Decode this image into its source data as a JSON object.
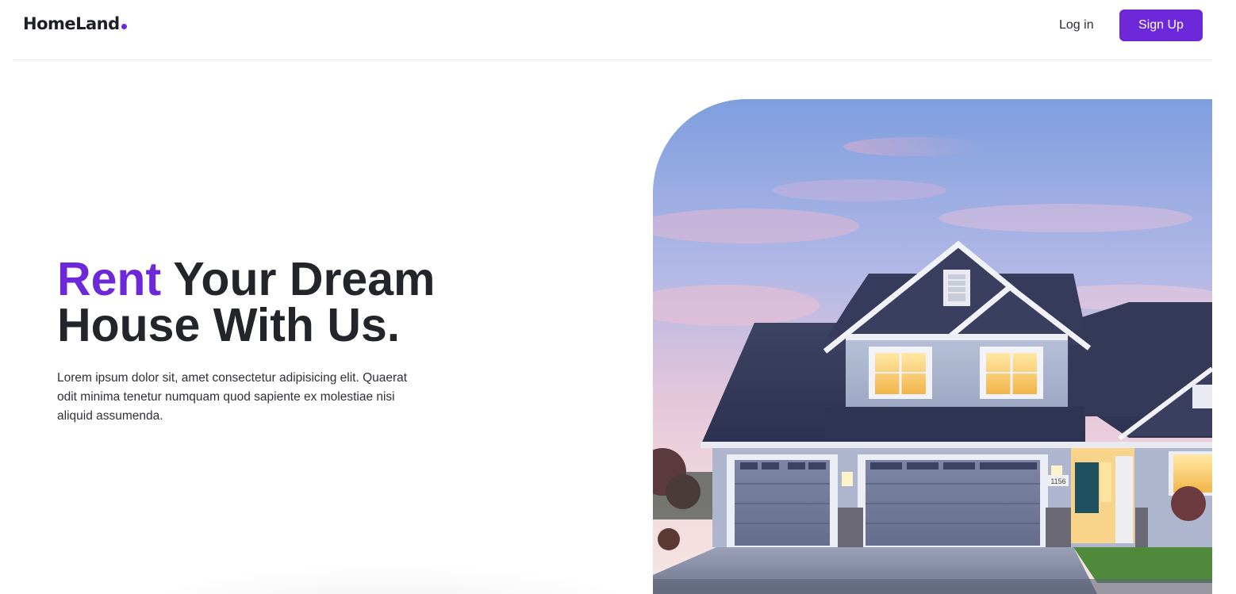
{
  "header": {
    "brand": "HomeLand",
    "brand_dot_color": "#6d28d9",
    "login_label": "Log in",
    "signup_label": "Sign Up",
    "accent_color": "#6d28d9"
  },
  "hero": {
    "title_accent": "Rent",
    "title_rest_line1": " Your Dream",
    "title_line2": "House With Us.",
    "description": "Lorem ipsum dolor sit, amet consectetur adipisicing elit. Quaerat odit minima tenetur numquam quod sapiente ex molestiae nisi aliquid assumenda.",
    "image_subject": "house-photo",
    "house_number": "1156"
  }
}
